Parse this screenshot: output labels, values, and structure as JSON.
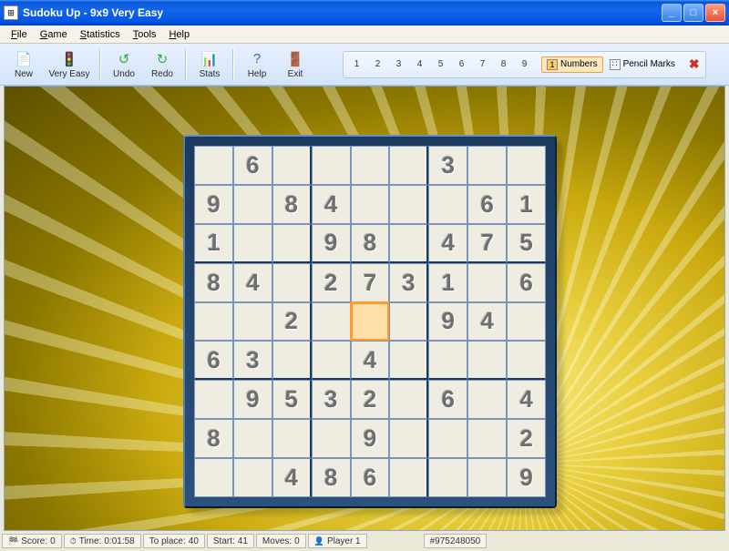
{
  "window": {
    "title": "Sudoku Up - 9x9 Very Easy"
  },
  "menu": {
    "file": "File",
    "game": "Game",
    "statistics": "Statistics",
    "tools": "Tools",
    "help": "Help"
  },
  "toolbar": {
    "new": "New",
    "difficulty": "Very Easy",
    "undo": "Undo",
    "redo": "Redo",
    "stats": "Stats",
    "help": "Help",
    "exit": "Exit"
  },
  "numbar": {
    "numbers": [
      "1",
      "2",
      "3",
      "4",
      "5",
      "6",
      "7",
      "8",
      "9"
    ],
    "numbers_mode": "Numbers",
    "pencil_mode": "Pencil Marks"
  },
  "status": {
    "score_label": "Score:",
    "score_value": "0",
    "time_label": "Time:",
    "time_value": "0:01:58",
    "toplace_label": "To place:",
    "toplace_value": "40",
    "start_label": "Start:",
    "start_value": "41",
    "moves_label": "Moves:",
    "moves_value": "0",
    "player_label": "Player 1",
    "game_id": "#975248050"
  },
  "board": {
    "selected": [
      4,
      4
    ],
    "cells": [
      [
        "",
        "6",
        "",
        "",
        "",
        "",
        "3",
        "",
        ""
      ],
      [
        "9",
        "",
        "8",
        "4",
        "",
        "",
        "",
        "6",
        "1"
      ],
      [
        "1",
        "",
        "",
        "9",
        "8",
        "",
        "4",
        "7",
        "5"
      ],
      [
        "8",
        "4",
        "",
        "2",
        "7",
        "3",
        "1",
        "",
        "6"
      ],
      [
        "",
        "",
        "2",
        "",
        "",
        "",
        "9",
        "4",
        ""
      ],
      [
        "6",
        "3",
        "",
        "",
        "4",
        "",
        "",
        "",
        ""
      ],
      [
        "",
        "9",
        "5",
        "3",
        "2",
        "",
        "6",
        "",
        "4"
      ],
      [
        "8",
        "",
        "",
        "",
        "9",
        "",
        "",
        "",
        "2"
      ],
      [
        "",
        "",
        "4",
        "8",
        "6",
        "",
        "",
        "",
        "9"
      ]
    ]
  }
}
